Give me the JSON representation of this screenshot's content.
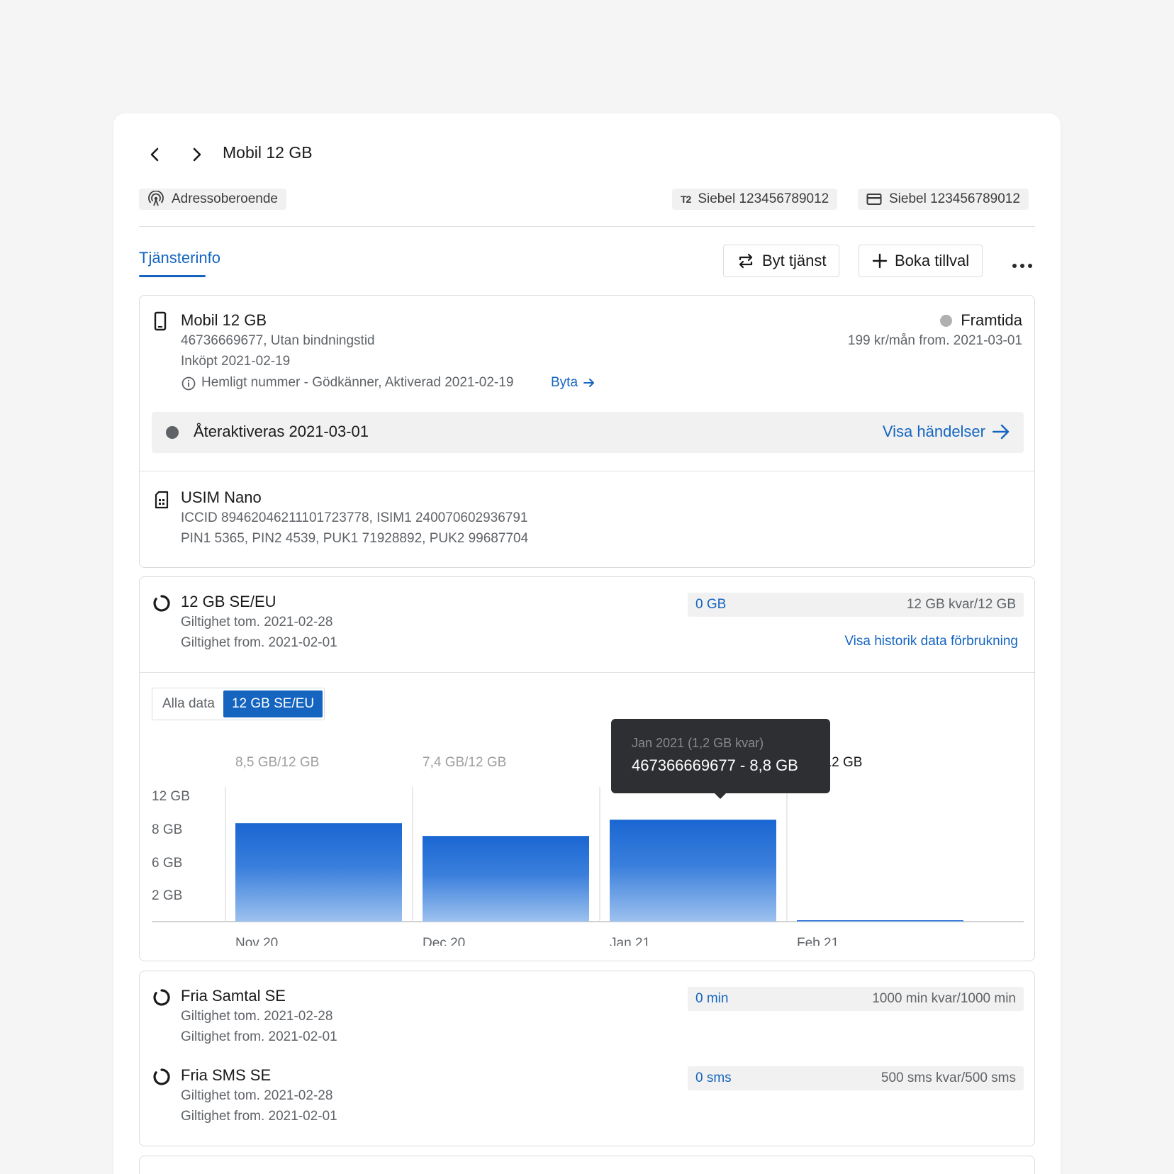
{
  "header": {
    "title": "Mobil 12 GB",
    "chip_location": "Adressoberoende",
    "chip_t2": "Siebel 123456789012",
    "chip_t2_logo": "T2",
    "chip_card": "Siebel 123456789012"
  },
  "tabs": {
    "active": "Tjänsterinfo"
  },
  "actions": {
    "swap": "Byt tjänst",
    "addon": "Boka tillval"
  },
  "subscription": {
    "title": "Mobil 12 GB",
    "line1": "46736669677, Utan bindningstid",
    "line2": "Inköpt 2021-02-19",
    "line3": "Hemligt nummer - Gödkänner, Aktiverad 2021-02-19",
    "change_link": "Byta",
    "status": "Framtida",
    "price": "199 kr/mån from. 2021-03-01",
    "status_bar_text": "Återaktiveras 2021-03-01",
    "events_link": "Visa händelser"
  },
  "sim": {
    "title": "USIM Nano",
    "line1": "ICCID 8946204621110172377​8, ISIM1 240070602936791",
    "line2": "PIN1 5365, PIN2 4539, PUK1 71928892, PUK2 99687704"
  },
  "data_package": {
    "title": "12 GB SE/EU",
    "valid_to": "Giltighet tom. 2021-02-28",
    "valid_from": "Giltighet from. 2021-02-01",
    "used": "0 GB",
    "remaining": "12 GB kvar/12 GB",
    "history_link": "Visa historik data förbrukning",
    "filter_all": "Alla data",
    "filter_pkg": "12 GB SE/EU"
  },
  "chart_data": {
    "type": "bar",
    "categories": [
      "Nov 20",
      "Dec 20",
      "Jan 21",
      "Feb 21"
    ],
    "values": [
      8.5,
      7.4,
      8.8,
      0.1
    ],
    "top_labels": [
      "8,5 GB/12 GB",
      "7,4 GB/12 GB",
      "",
      "7 GB/12 GB"
    ],
    "yticks": [
      "12 GB",
      "8 GB",
      "6 GB",
      "2 GB"
    ],
    "ylim": [
      0,
      12
    ],
    "tooltip": {
      "title": "Jan 2021 (1,2 GB kvar)",
      "value": "467366669677 - 8,8 GB"
    }
  },
  "calls": {
    "title": "Fria Samtal SE",
    "valid_to": "Giltighet tom. 2021-02-28",
    "valid_from": "Giltighet from. 2021-02-01",
    "used": "0 min",
    "remaining": "1000 min kvar/1000 min"
  },
  "sms": {
    "title": "Fria SMS SE",
    "valid_to": "Giltighet tom. 2021-02-28",
    "valid_from": "Giltighet from. 2021-02-01",
    "used": "0 sms",
    "remaining": "500 sms kvar/500 sms"
  }
}
